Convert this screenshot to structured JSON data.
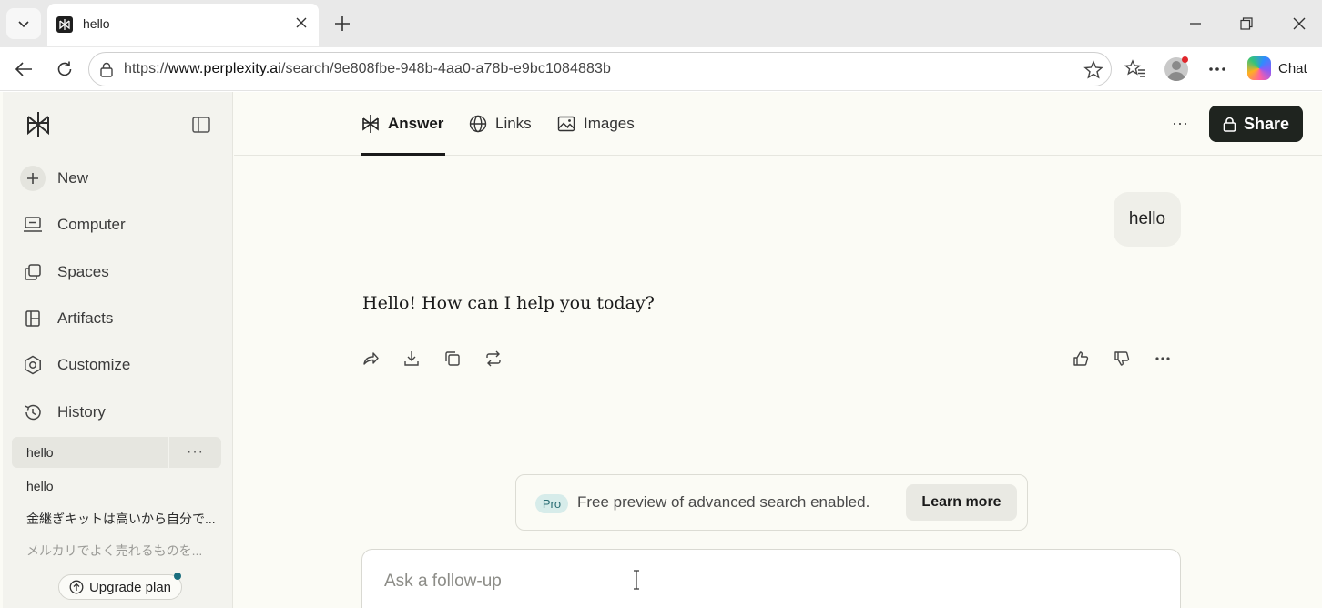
{
  "browser": {
    "tab_title": "hello",
    "url_scheme": "https://",
    "url_host": "www.perplexity.ai",
    "url_path": "/search/9e808fbe-948b-4aa0-a78b-e9bc1084883b",
    "copilot_label": "Chat"
  },
  "sidebar": {
    "nav": [
      {
        "label": "New",
        "icon": "plus-icon"
      },
      {
        "label": "Computer",
        "icon": "computer-icon"
      },
      {
        "label": "Spaces",
        "icon": "spaces-icon"
      },
      {
        "label": "Artifacts",
        "icon": "artifacts-icon"
      },
      {
        "label": "Customize",
        "icon": "customize-icon"
      },
      {
        "label": "History",
        "icon": "history-icon"
      }
    ],
    "history": [
      {
        "label": "hello",
        "active": true
      },
      {
        "label": "hello",
        "active": false
      },
      {
        "label": "金継ぎキットは高いから自分で...",
        "active": false
      },
      {
        "label": "メルカリでよく売れるものを...",
        "active": false
      }
    ],
    "more_glyph": "···",
    "upgrade_label": "Upgrade plan"
  },
  "main": {
    "tabs": [
      {
        "label": "Answer",
        "icon": "perplexity-icon",
        "active": true
      },
      {
        "label": "Links",
        "icon": "globe-icon",
        "active": false
      },
      {
        "label": "Images",
        "icon": "image-icon",
        "active": false
      }
    ],
    "more_glyph": "···",
    "share_label": "Share",
    "user_query": "hello",
    "answer_text": "Hello! How can I help you today?",
    "pro_banner": {
      "badge": "Pro",
      "text": "Free preview of advanced search enabled.",
      "button": "Learn more"
    },
    "followup_placeholder": "Ask a follow-up"
  },
  "colors": {
    "app_bg": "#fbfbf5",
    "sidebar_bg": "#f3f3ee",
    "share_bg": "#1f241f",
    "pro_badge_bg": "#d7ecea",
    "pro_badge_text": "#2b6e74"
  }
}
